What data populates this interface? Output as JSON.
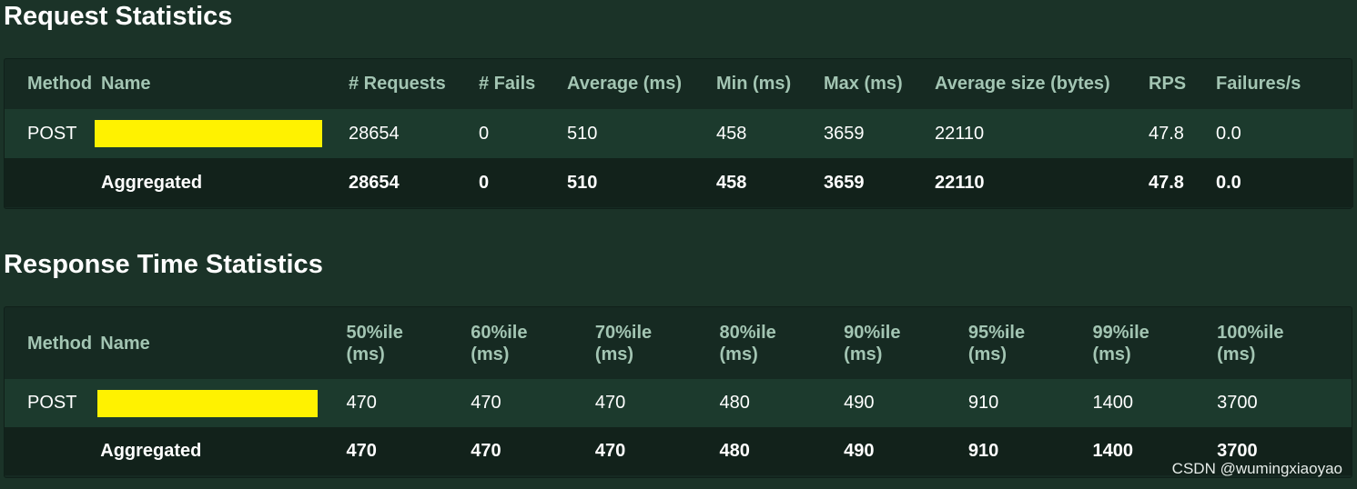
{
  "request_stats": {
    "title": "Request Statistics",
    "headers": [
      "Method",
      "Name",
      "# Requests",
      "# Fails",
      "Average (ms)",
      "Min (ms)",
      "Max (ms)",
      "Average size (bytes)",
      "RPS",
      "Failures/s"
    ],
    "row": {
      "method": "POST",
      "requests": "28654",
      "fails": "0",
      "average": "510",
      "min": "458",
      "max": "3659",
      "avg_size": "22110",
      "rps": "47.8",
      "failures_per_s": "0.0"
    },
    "aggregated": {
      "name": "Aggregated",
      "requests": "28654",
      "fails": "0",
      "average": "510",
      "min": "458",
      "max": "3659",
      "avg_size": "22110",
      "rps": "47.8",
      "failures_per_s": "0.0"
    }
  },
  "response_stats": {
    "title": "Response Time Statistics",
    "headers": {
      "method": "Method",
      "name": "Name",
      "p50": [
        "50%ile",
        "(ms)"
      ],
      "p60": [
        "60%ile",
        "(ms)"
      ],
      "p70": [
        "70%ile",
        "(ms)"
      ],
      "p80": [
        "80%ile",
        "(ms)"
      ],
      "p90": [
        "90%ile",
        "(ms)"
      ],
      "p95": [
        "95%ile",
        "(ms)"
      ],
      "p99": [
        "99%ile",
        "(ms)"
      ],
      "p100": [
        "100%ile",
        "(ms)"
      ]
    },
    "row": {
      "method": "POST",
      "p50": "470",
      "p60": "470",
      "p70": "470",
      "p80": "480",
      "p90": "490",
      "p95": "910",
      "p99": "1400",
      "p100": "3700"
    },
    "aggregated": {
      "name": "Aggregated",
      "p50": "470",
      "p60": "470",
      "p70": "470",
      "p80": "480",
      "p90": "490",
      "p95": "910",
      "p99": "1400",
      "p100": "3700"
    }
  },
  "watermark": "CSDN @wumingxiaoyao",
  "colors": {
    "background": "#1b3328",
    "header_text": "#a3c5b3",
    "redaction": "#fff200"
  }
}
